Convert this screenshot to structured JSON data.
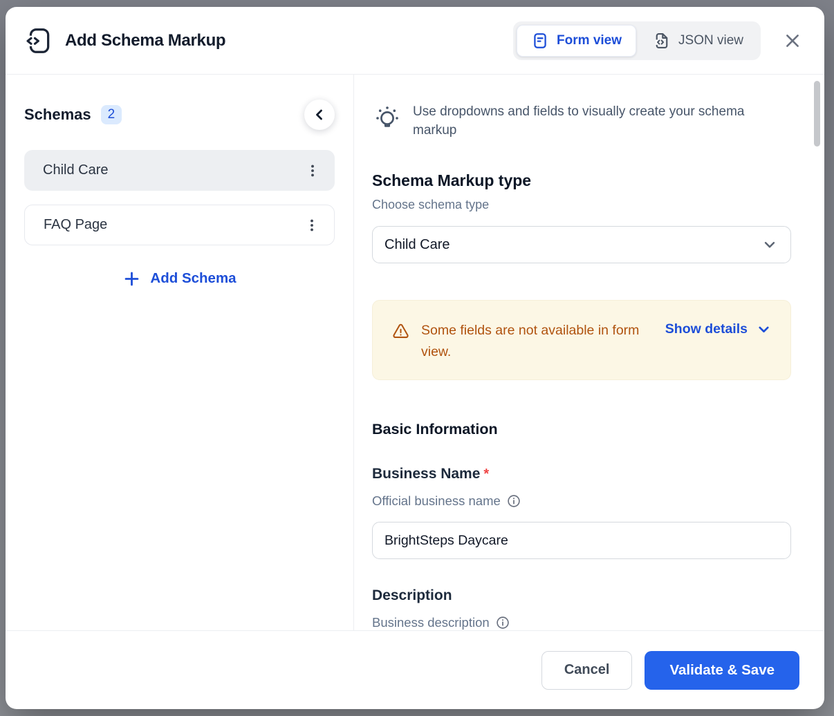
{
  "header": {
    "title": "Add Schema Markup",
    "form_view": "Form view",
    "json_view": "JSON view"
  },
  "sidebar": {
    "heading": "Schemas",
    "count": "2",
    "items": [
      {
        "label": "Child Care"
      },
      {
        "label": "FAQ Page"
      }
    ],
    "add_schema": "Add Schema"
  },
  "main": {
    "hint": "Use dropdowns and fields to visually create your schema markup",
    "schema_type": {
      "heading": "Schema Markup type",
      "subheading": "Choose schema type",
      "value": "Child Care"
    },
    "warning": {
      "message": "Some fields are not available in form view.",
      "action": "Show details"
    },
    "basic": {
      "heading": "Basic Information",
      "business_name_label": "Business Name",
      "required_mark": "*",
      "business_name_help": "Official business name",
      "business_name_value": "BrightSteps Daycare",
      "description_label": "Description",
      "description_help": "Business description"
    }
  },
  "footer": {
    "cancel": "Cancel",
    "submit": "Validate & Save"
  },
  "colors": {
    "accent_blue": "#1d4ed8",
    "button_blue": "#2563eb",
    "warning_text": "#b0530f",
    "warning_bg": "#fcf7e5",
    "badge_bg": "#dbeafe",
    "required_red": "#ef4444"
  }
}
